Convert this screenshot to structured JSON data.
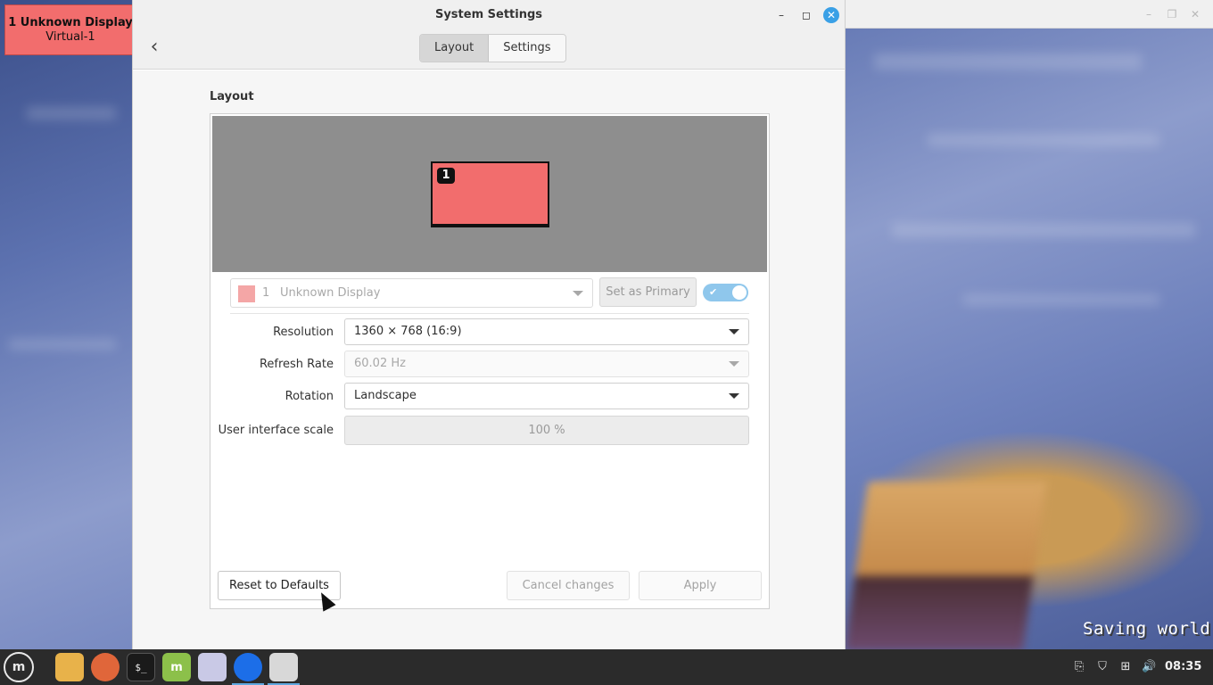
{
  "window": {
    "title": "System Settings",
    "tabs": [
      {
        "label": "Layout",
        "active": true
      },
      {
        "label": "Settings",
        "active": false
      }
    ]
  },
  "display_badge": {
    "line1": "1  Unknown Display",
    "line2": "Virtual-1",
    "color": "#f26d6d"
  },
  "layout": {
    "heading": "Layout",
    "monitor_number": "1",
    "monitor_selector": {
      "number": "1",
      "name": "Unknown Display",
      "swatch_color": "#f4a6a6"
    },
    "set_primary_label": "Set as Primary",
    "enabled": true,
    "settings": {
      "resolution": {
        "label": "Resolution",
        "value": "1360 × 768 (16:9)"
      },
      "refresh_rate": {
        "label": "Refresh Rate",
        "value": "60.02 Hz"
      },
      "rotation": {
        "label": "Rotation",
        "value": "Landscape"
      },
      "ui_scale": {
        "label": "User interface scale",
        "value": "100 %"
      }
    },
    "buttons": {
      "reset": "Reset to Defaults",
      "cancel": "Cancel changes",
      "apply": "Apply"
    }
  },
  "background": {
    "game_text": "Saving world"
  },
  "taskbar": {
    "launchers": [
      {
        "icon": "mint-menu-icon"
      },
      {
        "icon": "folder-icon"
      },
      {
        "icon": "firefox-icon"
      },
      {
        "icon": "terminal-icon",
        "glyph": "$_"
      },
      {
        "icon": "mintinstall-icon",
        "glyph": "m"
      },
      {
        "icon": "text-editor-icon"
      },
      {
        "icon": "blue-app-icon"
      },
      {
        "icon": "settings-icon"
      }
    ],
    "clock": "08:35",
    "tray": [
      "clipboard-icon",
      "shield-icon",
      "network-icon",
      "volume-icon"
    ]
  },
  "colors": {
    "accent": "#3aa0e6",
    "monitor": "#f26d6d",
    "toggle_on": "#8fc7ec"
  }
}
